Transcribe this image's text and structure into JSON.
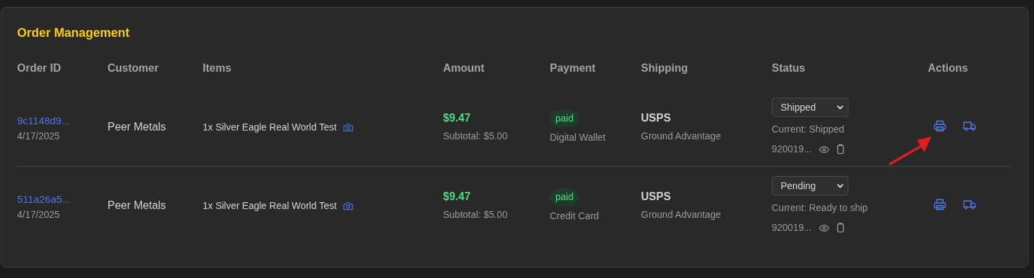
{
  "title": "Order Management",
  "columns": [
    "Order ID",
    "Customer",
    "Items",
    "Amount",
    "Payment",
    "Shipping",
    "Status",
    "Actions"
  ],
  "rows": [
    {
      "order_id": "9c1148d9...",
      "date": "4/17/2025",
      "customer": "Peer Metals",
      "item": "1x Silver Eagle Real World Test",
      "amount": "$9.47",
      "subtotal": "Subtotal: $5.00",
      "payment_status": "paid",
      "payment_method": "Digital Wallet",
      "carrier": "USPS",
      "service": "Ground Advantage",
      "status": "Shipped",
      "current": "Current: Shipped",
      "tracking": "920019..."
    },
    {
      "order_id": "511a26a5...",
      "date": "4/17/2025",
      "customer": "Peer Metals",
      "item": "1x Silver Eagle Real World Test",
      "amount": "$9.47",
      "subtotal": "Subtotal: $5.00",
      "payment_status": "paid",
      "payment_method": "Credit Card",
      "carrier": "USPS",
      "service": "Ground Advantage",
      "status": "Pending",
      "current": "Current: Ready to ship",
      "tracking": "920019..."
    }
  ]
}
